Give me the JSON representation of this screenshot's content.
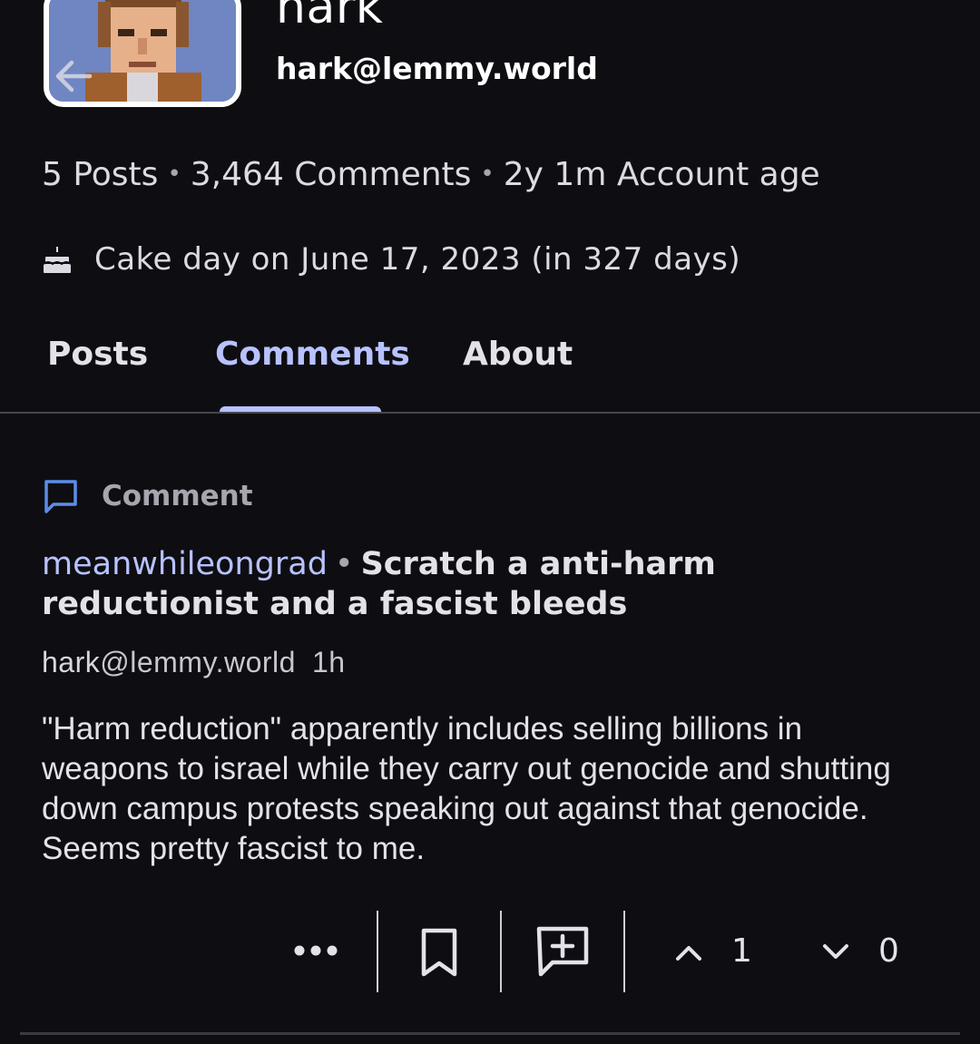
{
  "profile": {
    "display_name": "hark",
    "handle": "hark@lemmy.world",
    "stats": {
      "posts": "5 Posts",
      "comments": "3,464 Comments",
      "age": "2y 1m Account age"
    },
    "cake_day": "Cake day on June 17, 2023 (in 327 days)"
  },
  "tabs": [
    {
      "label": "Posts"
    },
    {
      "label": "Comments",
      "active": true
    },
    {
      "label": "About"
    }
  ],
  "comment": {
    "type_label": "Comment",
    "community": "meanwhileongrad",
    "post_title": "Scratch a anti-harm reductionist and a fascist bleeds",
    "author_name": "hark",
    "author_instance": "@lemmy.world",
    "age": "1h",
    "body": "\"Harm reduction\" apparently includes selling billions in weapons to israel while they carry out genocide and shutting down campus protests speaking out against that genocide. Seems pretty fascist to me.",
    "upvotes": "1",
    "downvotes": "0"
  },
  "colors": {
    "background": "#0e0e12",
    "accent": "#b8c2ff",
    "comment_icon": "#5c8ee8"
  },
  "icons": [
    "back-arrow-icon",
    "cake-icon",
    "comment-icon",
    "more-options-icon",
    "bookmark-icon",
    "reply-icon",
    "upvote-icon",
    "downvote-icon"
  ]
}
